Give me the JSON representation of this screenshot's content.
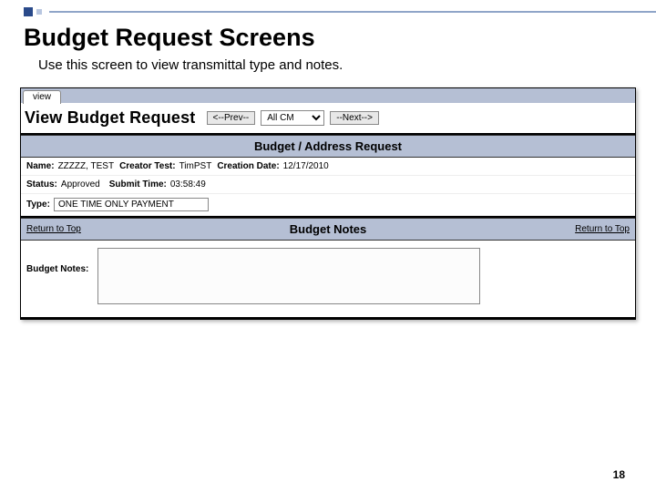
{
  "slide": {
    "title": "Budget Request Screens",
    "subtitle": "Use this screen to view transmittal type and notes.",
    "pageNumber": "18"
  },
  "app": {
    "tab": "view",
    "viewTitle": "View Budget Request",
    "nav": {
      "prev": "<--Prev--",
      "next": "--Next-->",
      "select": "All CM"
    },
    "section1": {
      "header": "Budget / Address Request",
      "nameLabel": "Name:",
      "nameValue": "ZZZZZ, TEST",
      "creatorLabel": "Creator Test:",
      "creatorValue": "TimPST",
      "creationDateLabel": "Creation Date:",
      "creationDateValue": "12/17/2010",
      "statusLabel": "Status:",
      "statusValue": "Approved",
      "submitTimeLabel": "Submit Time:",
      "submitTimeValue": "03:58:49",
      "typeLabel": "Type:",
      "typeValue": "ONE TIME ONLY PAYMENT"
    },
    "section2": {
      "header": "Budget Notes",
      "returnTop": "Return to Top",
      "notesLabel": "Budget Notes:",
      "notesValue": ""
    }
  }
}
